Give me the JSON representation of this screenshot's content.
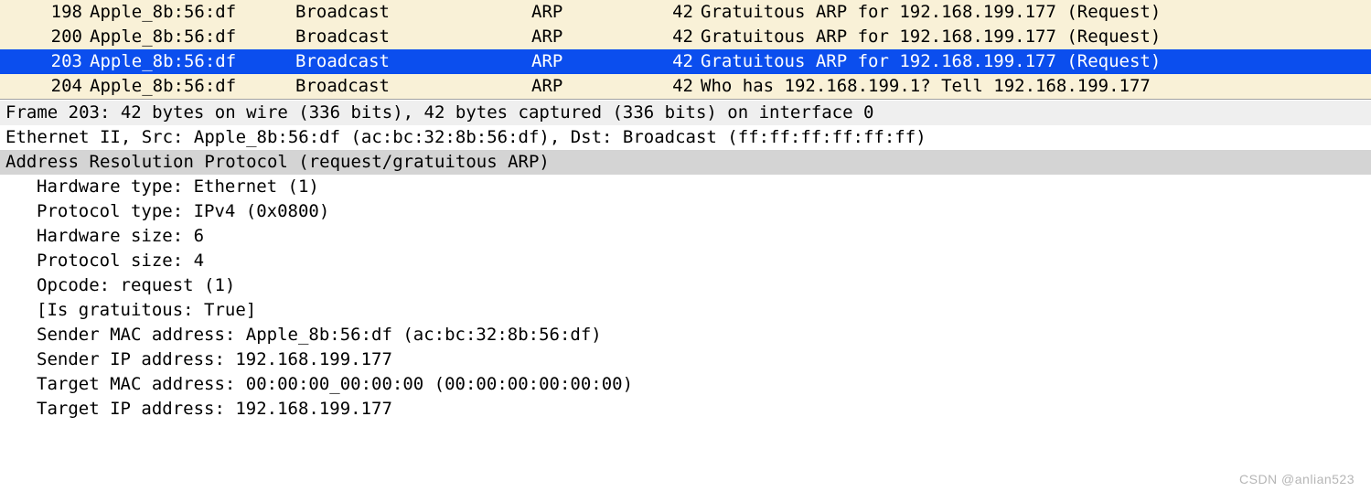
{
  "packets": [
    {
      "no": "198",
      "source": "Apple_8b:56:df",
      "dest": "Broadcast",
      "proto": "ARP",
      "len": "42",
      "info": "Gratuitous ARP for 192.168.199.177 (Request)",
      "selected": false
    },
    {
      "no": "200",
      "source": "Apple_8b:56:df",
      "dest": "Broadcast",
      "proto": "ARP",
      "len": "42",
      "info": "Gratuitous ARP for 192.168.199.177 (Request)",
      "selected": false
    },
    {
      "no": "203",
      "source": "Apple_8b:56:df",
      "dest": "Broadcast",
      "proto": "ARP",
      "len": "42",
      "info": "Gratuitous ARP for 192.168.199.177 (Request)",
      "selected": true
    },
    {
      "no": "204",
      "source": "Apple_8b:56:df",
      "dest": "Broadcast",
      "proto": "ARP",
      "len": "42",
      "info": "Who has 192.168.199.1? Tell 192.168.199.177",
      "selected": false
    }
  ],
  "details": {
    "frame": "Frame 203: 42 bytes on wire (336 bits), 42 bytes captured (336 bits) on interface 0",
    "ethernet": "Ethernet II, Src: Apple_8b:56:df (ac:bc:32:8b:56:df), Dst: Broadcast (ff:ff:ff:ff:ff:ff)",
    "arp_header": "Address Resolution Protocol (request/gratuitous ARP)",
    "hw_type": "Hardware type: Ethernet (1)",
    "proto_type": "Protocol type: IPv4 (0x0800)",
    "hw_size": "Hardware size: 6",
    "proto_size": "Protocol size: 4",
    "opcode": "Opcode: request (1)",
    "gratuitous": "[Is gratuitous: True]",
    "sender_mac": "Sender MAC address: Apple_8b:56:df (ac:bc:32:8b:56:df)",
    "sender_ip": "Sender IP address: 192.168.199.177",
    "target_mac": "Target MAC address: 00:00:00_00:00:00 (00:00:00:00:00:00)",
    "target_ip": "Target IP address: 192.168.199.177"
  },
  "watermark": "CSDN @anlian523"
}
